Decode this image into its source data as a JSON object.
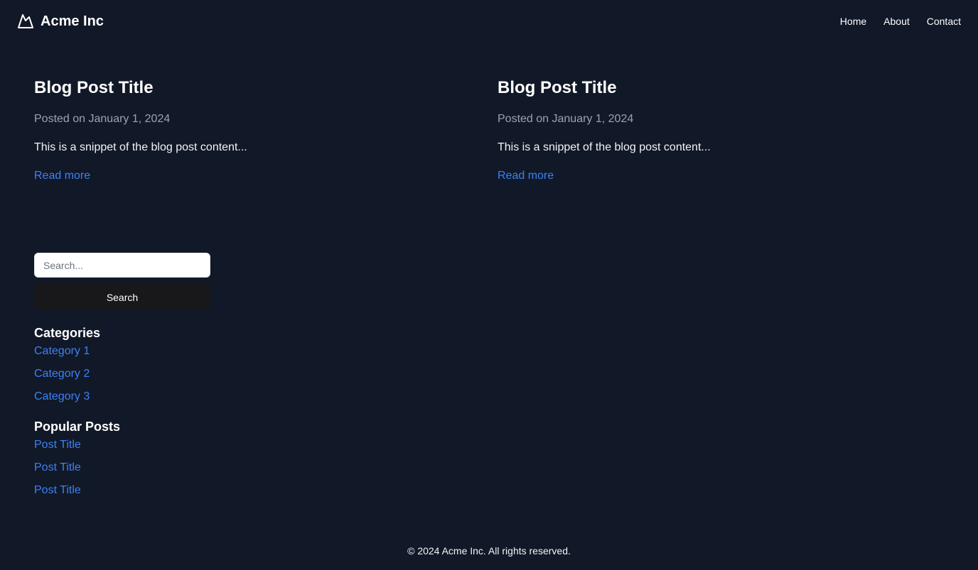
{
  "header": {
    "brand_name": "Acme Inc",
    "brand_icon": "mountain-icon",
    "nav": [
      "Home",
      "About",
      "Contact"
    ]
  },
  "posts": [
    {
      "title": "Blog Post Title",
      "date": "Posted on January 1, 2024",
      "snippet": "This is a snippet of the blog post content...",
      "link": "Read more"
    },
    {
      "title": "Blog Post Title",
      "date": "Posted on January 1, 2024",
      "snippet": "This is a snippet of the blog post content...",
      "link": "Read more"
    }
  ],
  "sidebar": {
    "search_placeholder": "Search...",
    "search_button": "Search",
    "categories_heading": "Categories",
    "categories": [
      "Category 1",
      "Category 2",
      "Category 3"
    ],
    "popular_heading": "Popular Posts",
    "popular": [
      "Post Title",
      "Post Title",
      "Post Title"
    ]
  },
  "footer": {
    "text": "© 2024 Acme Inc. All rights reserved."
  },
  "colors": {
    "background": "#111827",
    "link": "#3b82f6",
    "muted_text": "#9ca3af",
    "button_bg": "#18181b"
  }
}
